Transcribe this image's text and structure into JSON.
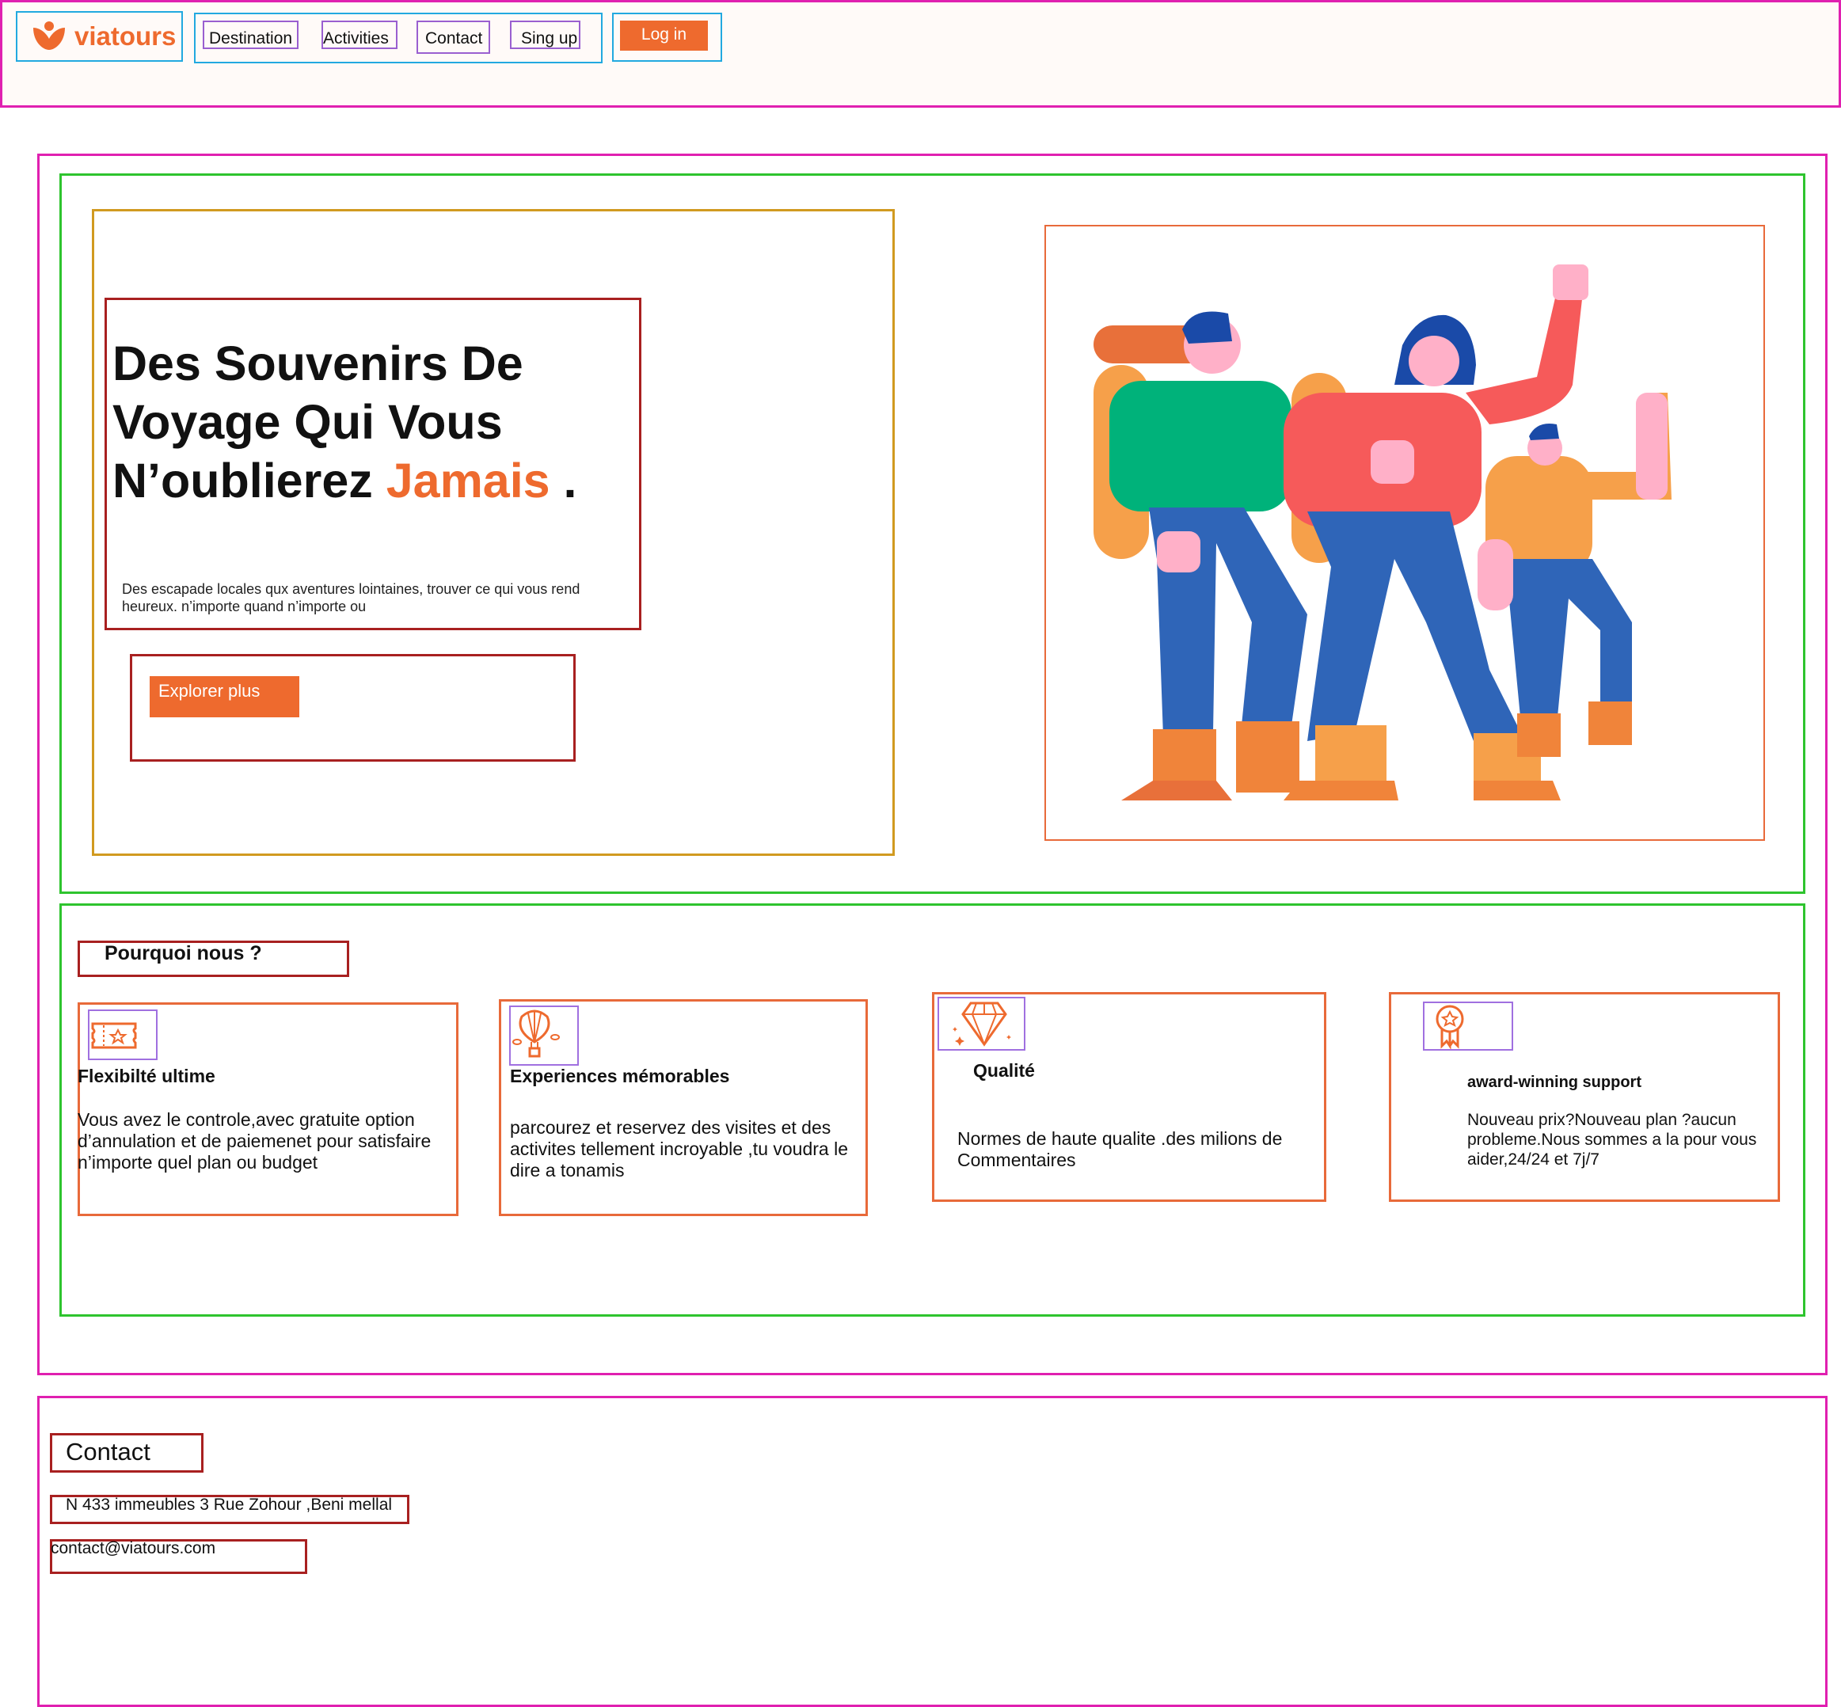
{
  "header": {
    "brand": "viatours",
    "nav": [
      "Destination",
      "Activities",
      "Contact",
      "Sing up"
    ],
    "login_label": "Log in"
  },
  "hero": {
    "title_line1": "Des Souvenirs De",
    "title_line2": "Voyage Qui Vous",
    "title_line3": "N’oublierez ",
    "title_accent": "Jamais",
    "title_end": " .",
    "subtitle": "Des escapade locales qux aventures lointaines, trouver ce qui vous rend heureux. n’importe quand n’importe ou",
    "cta_label": "Explorer plus"
  },
  "why": {
    "heading": "Pourquoi nous ?",
    "features": [
      {
        "icon": "ticket-icon",
        "title": "Flexibilté ultime",
        "text": "Vous avez le controle,avec gratuite option d’annulation et de paiemenet pour satisfaire n’importe quel plan ou budget"
      },
      {
        "icon": "hot-air-balloon-icon",
        "title": "Experiences mémorables",
        "text": "parcourez et reservez des visites et des activites tellement incroyable ,tu voudra le dire a tonamis"
      },
      {
        "icon": "diamond-icon",
        "title": "Qualité",
        "text": "Normes de haute qualite .des milions de Commentaires"
      },
      {
        "icon": "award-ribbon-icon",
        "title": "award-winning support",
        "text": "Nouveau prix?Nouveau plan ?aucun probleme.Nous sommes a la pour vous aider,24/24 et 7j/7"
      }
    ]
  },
  "contact": {
    "heading": "Contact",
    "address": "N 433 immeubles 3 Rue Zohour ,Beni mellal",
    "email": "contact@viatours.com"
  },
  "colors": {
    "accent": "#ee6a2e"
  }
}
